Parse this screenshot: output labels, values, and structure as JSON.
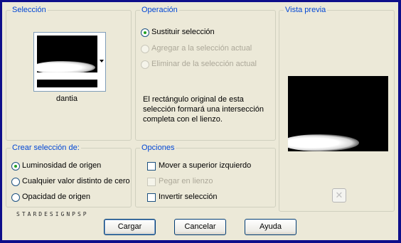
{
  "seleccion": {
    "title": "Selección",
    "thumbnail_name": "dantia"
  },
  "operacion": {
    "title": "Operación",
    "options": [
      {
        "label": "Sustituir selección",
        "selected": true,
        "enabled": true
      },
      {
        "label": "Agregar a la selección actual",
        "selected": false,
        "enabled": false
      },
      {
        "label": "Eliminar de la selección actual",
        "selected": false,
        "enabled": false
      }
    ],
    "description_lines": [
      "El rectángulo original de esta",
      "selección formará una intersección",
      "completa con el lienzo."
    ]
  },
  "vista_previa": {
    "title": "Vista previa"
  },
  "crear": {
    "title": "Crear selección de:",
    "options": [
      {
        "label": "Luminosidad de origen",
        "selected": true
      },
      {
        "label": "Cualquier valor distinto de cero",
        "selected": false
      },
      {
        "label": "Opacidad de origen",
        "selected": false
      }
    ]
  },
  "opciones": {
    "title": "Opciones",
    "checks": [
      {
        "label": "Mover a superior izquierdo",
        "checked": false,
        "enabled": true
      },
      {
        "label": "Pegar en lienzo",
        "checked": false,
        "enabled": false
      },
      {
        "label": "Invertir selección",
        "checked": false,
        "enabled": true
      }
    ]
  },
  "watermark": "STARDESIGNPSP",
  "buttons": {
    "load": "Cargar",
    "cancel": "Cancelar",
    "help": "Ayuda"
  },
  "colors": {
    "frame": "#0e0e8a",
    "dialog_bg": "#ece9d8",
    "group_title": "#0046d5"
  }
}
